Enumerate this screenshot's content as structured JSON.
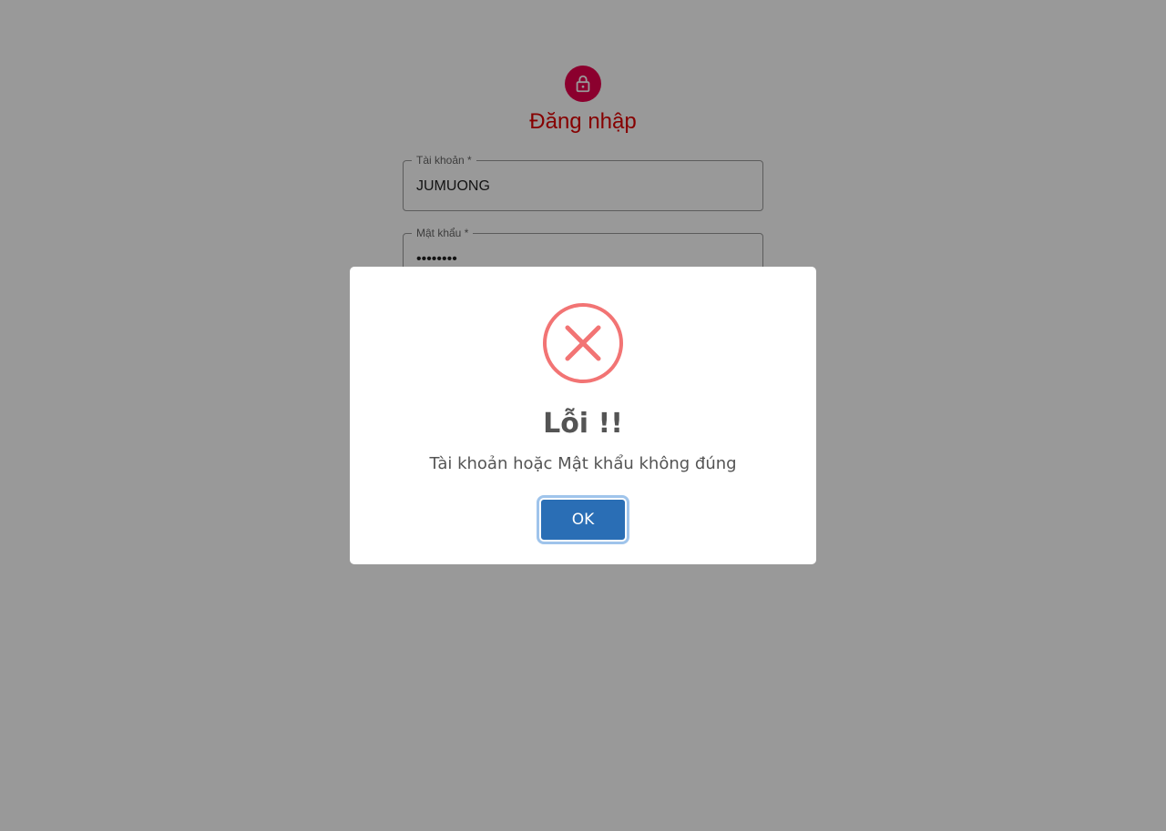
{
  "login": {
    "title": "Đăng nhập",
    "username": {
      "label": "Tài khoản *",
      "value": "JUMUONG"
    },
    "password": {
      "label": "Mật khẩu *",
      "value": "••••••••"
    },
    "icon": "lock-icon",
    "accent_color": "#e8004e"
  },
  "dialog": {
    "icon": "error-x-icon",
    "icon_color": "#f27474",
    "title": "Lỗi !!",
    "message": "Tài khoản hoặc Mật khẩu không đúng",
    "ok_label": "OK",
    "button_color": "#2a6eb5"
  }
}
